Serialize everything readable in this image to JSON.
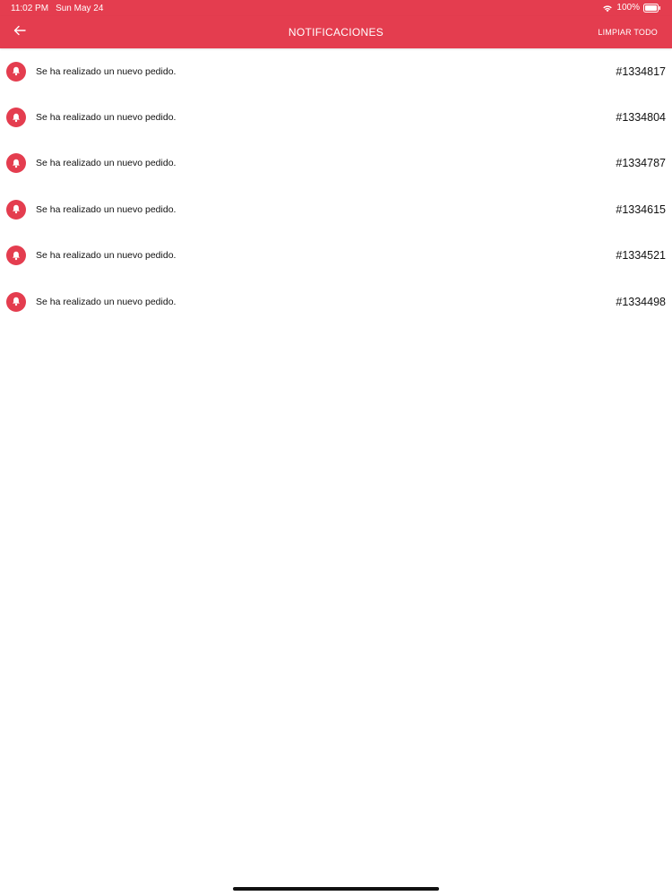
{
  "status_bar": {
    "time": "11:02 PM",
    "date": "Sun May 24",
    "battery": "100%"
  },
  "header": {
    "title": "NOTIFICACIONES",
    "clear_all_label": "LIMPIAR TODO"
  },
  "notifications": [
    {
      "message": "Se ha realizado un nuevo pedido.",
      "order": "#1334817"
    },
    {
      "message": "Se ha realizado un nuevo pedido.",
      "order": "#1334804"
    },
    {
      "message": "Se ha realizado un nuevo pedido.",
      "order": "#1334787"
    },
    {
      "message": "Se ha realizado un nuevo pedido.",
      "order": "#1334615"
    },
    {
      "message": "Se ha realizado un nuevo pedido.",
      "order": "#1334521"
    },
    {
      "message": "Se ha realizado un nuevo pedido.",
      "order": "#1334498"
    }
  ],
  "colors": {
    "brand": "#e43d4f",
    "text": "#111111",
    "background": "#ffffff"
  },
  "icons": {
    "back": "arrow-left-icon",
    "notification": "bell-icon",
    "wifi": "wifi-icon",
    "battery": "battery-icon"
  }
}
